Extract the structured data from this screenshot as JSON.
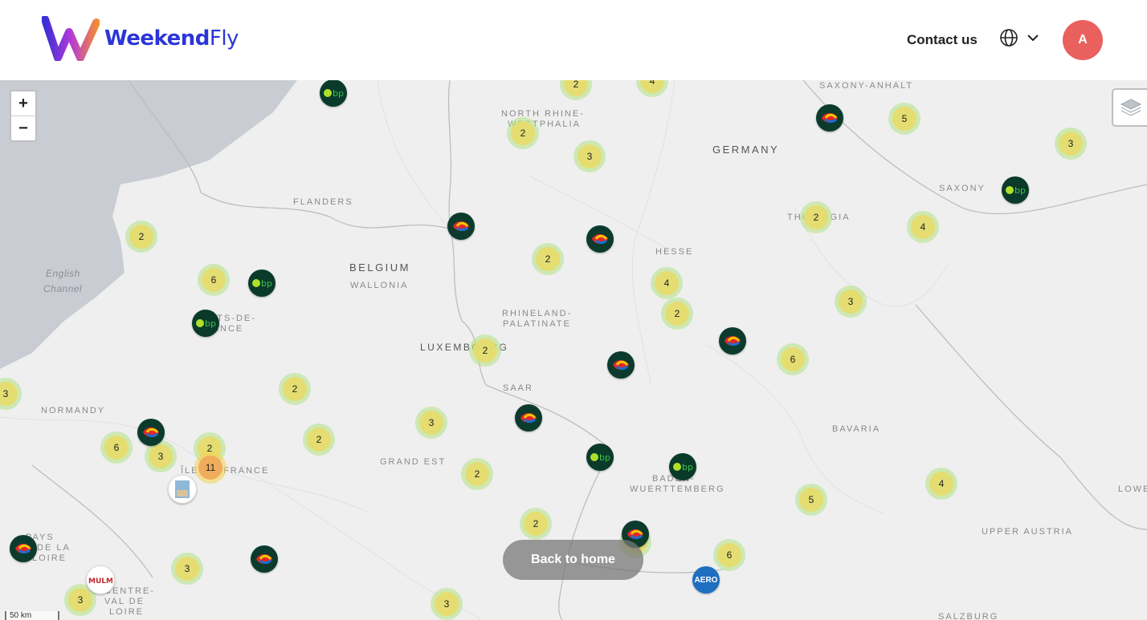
{
  "header": {
    "logo_text_bold": "Weekend",
    "logo_text_light": "Fly",
    "contact_label": "Contact us",
    "avatar_initial": "A",
    "globe_icon": "globe-icon",
    "chevron_icon": "chevron-down-icon"
  },
  "map": {
    "zoom_in": "+",
    "zoom_out": "−",
    "back_label": "Back to home",
    "scale_label": "50 km",
    "colors": {
      "cluster_outer": "#b5e28c",
      "cluster_inner": "#e6dc6e",
      "big_outer": "#f1d357",
      "big_inner": "#f0aa5a",
      "water": "#c9ccd3"
    },
    "place_labels": [
      {
        "text": "SAXONY-ANHALT",
        "type": "region"
      },
      {
        "text": "NORTH RHINE-",
        "type": "region"
      },
      {
        "text": "WESTPHALIA",
        "type": "region"
      },
      {
        "text": "GERMANY",
        "type": "country"
      },
      {
        "text": "SAXONY",
        "type": "region"
      },
      {
        "text": "FLANDERS",
        "type": "region"
      },
      {
        "text": "THURINGIA",
        "type": "region"
      },
      {
        "text": "BELGIUM",
        "type": "country"
      },
      {
        "text": "HESSE",
        "type": "region"
      },
      {
        "text": "WALLONIA",
        "type": "region"
      },
      {
        "text": "English",
        "type": "sea"
      },
      {
        "text": "Channel",
        "type": "sea"
      },
      {
        "text": "RHINELAND-",
        "type": "region"
      },
      {
        "text": "PALATINATE",
        "type": "region"
      },
      {
        "text": "HAUTS-DE-",
        "type": "region"
      },
      {
        "text": "FRANCE",
        "type": "region"
      },
      {
        "text": "LUXEMBOURG",
        "type": "country"
      },
      {
        "text": "SAAR",
        "type": "region"
      },
      {
        "text": "NORMANDY",
        "type": "region"
      },
      {
        "text": "BAVARIA",
        "type": "region"
      },
      {
        "text": "GRAND EST",
        "type": "region"
      },
      {
        "text": "ÎLE-DE-FRANCE",
        "type": "region"
      },
      {
        "text": "BADEN-",
        "type": "region"
      },
      {
        "text": "WUERTTEMBERG",
        "type": "region"
      },
      {
        "text": "LOWE",
        "type": "region"
      },
      {
        "text": "UPPER AUSTRIA",
        "type": "region"
      },
      {
        "text": "PAYS",
        "type": "region"
      },
      {
        "text": "DE LA",
        "type": "region"
      },
      {
        "text": "LOIRE",
        "type": "region"
      },
      {
        "text": "CENTRE-",
        "type": "region"
      },
      {
        "text": "VAL DE",
        "type": "region"
      },
      {
        "text": "LOIRE",
        "type": "region"
      },
      {
        "text": "SALZBURG",
        "type": "region"
      }
    ],
    "clusters": [
      {
        "count": "2"
      },
      {
        "count": "4"
      },
      {
        "count": "2"
      },
      {
        "count": "3"
      },
      {
        "count": "5"
      },
      {
        "count": "3"
      },
      {
        "count": "2"
      },
      {
        "count": "2"
      },
      {
        "count": "4"
      },
      {
        "count": "6"
      },
      {
        "count": "4"
      },
      {
        "count": "2"
      },
      {
        "count": "3"
      },
      {
        "count": "2"
      },
      {
        "count": "6"
      },
      {
        "count": "3"
      },
      {
        "count": "2"
      },
      {
        "count": "3"
      },
      {
        "count": "2"
      },
      {
        "count": "6"
      },
      {
        "count": "2"
      },
      {
        "count": "3"
      },
      {
        "count": "11"
      },
      {
        "count": "2"
      },
      {
        "count": "4"
      },
      {
        "count": "5"
      },
      {
        "count": "2"
      },
      {
        "count": "6"
      },
      {
        "count": "3"
      },
      {
        "count": "3"
      },
      {
        "count": "3"
      },
      {
        "count": "2"
      }
    ],
    "markers": [
      {
        "brand": "bp",
        "icon": "bp-logo-icon"
      },
      {
        "brand": "totalenergies",
        "icon": "totalenergies-logo-icon"
      },
      {
        "brand": "bp",
        "icon": "bp-logo-icon"
      },
      {
        "brand": "totalenergies",
        "icon": "totalenergies-logo-icon"
      },
      {
        "brand": "totalenergies",
        "icon": "totalenergies-logo-icon"
      },
      {
        "brand": "bp",
        "icon": "bp-logo-icon"
      },
      {
        "brand": "bp",
        "icon": "bp-logo-icon"
      },
      {
        "brand": "totalenergies",
        "icon": "totalenergies-logo-icon"
      },
      {
        "brand": "totalenergies",
        "icon": "totalenergies-logo-icon"
      },
      {
        "brand": "totalenergies",
        "icon": "totalenergies-logo-icon"
      },
      {
        "brand": "bp",
        "icon": "bp-logo-icon"
      },
      {
        "brand": "bp",
        "icon": "bp-logo-icon"
      },
      {
        "brand": "totalenergies",
        "icon": "totalenergies-logo-icon"
      },
      {
        "brand": "airport",
        "icon": "airport-photo-icon"
      },
      {
        "brand": "totalenergies",
        "icon": "totalenergies-logo-icon"
      },
      {
        "brand": "totalenergies",
        "icon": "totalenergies-logo-icon"
      },
      {
        "brand": "mulm",
        "icon": "mulm-logo-icon"
      },
      {
        "brand": "aero",
        "icon": "aero-logo-icon",
        "text": "AERO"
      },
      {
        "brand": "totalenergies",
        "icon": "totalenergies-logo-icon"
      }
    ]
  }
}
